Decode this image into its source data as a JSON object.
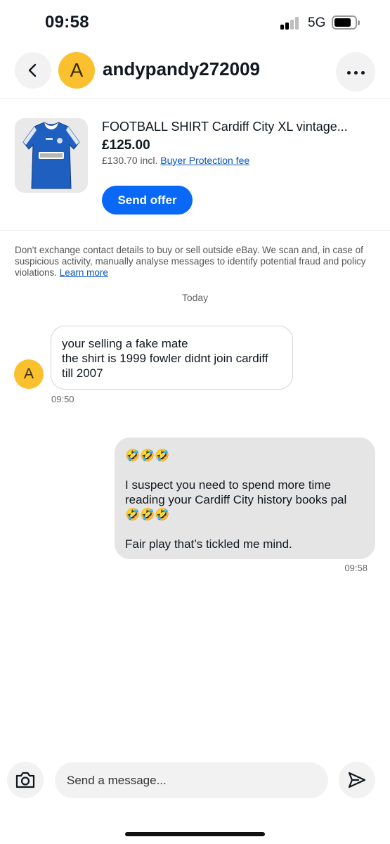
{
  "status_bar": {
    "time": "09:58",
    "network": "5G"
  },
  "header": {
    "avatar_letter": "A",
    "username": "andypandy272009"
  },
  "item": {
    "title": "FOOTBALL SHIRT Cardiff City XL vintage...",
    "price": "£125.00",
    "incl_text": "£130.70 incl. ",
    "protection_link": "Buyer Protection fee",
    "offer_button": "Send offer"
  },
  "notice": {
    "text": "Don't exchange contact details to buy or sell outside eBay. We scan and, in case of suspicious activity, manually analyse messages to identify potential fraud and policy violations. ",
    "link": "Learn more"
  },
  "day_label": "Today",
  "messages": [
    {
      "direction": "incoming",
      "avatar_letter": "A",
      "lines": [
        "your selling a fake mate",
        "the shirt is 1999 fowler didnt join cardiff till 2007"
      ],
      "time": "09:50"
    },
    {
      "direction": "outgoing",
      "lines": [
        "🤣🤣🤣",
        "",
        "I suspect you need to spend more time reading your Cardiff City history books pal 🤣🤣🤣",
        "",
        "Fair play that’s tickled me mind."
      ],
      "time": "09:58"
    }
  ],
  "composer": {
    "placeholder": "Send a message..."
  },
  "icons": {
    "back": "chevron-left-icon",
    "more": "more-horizontal-icon",
    "camera": "camera-icon",
    "send": "send-icon"
  },
  "colors": {
    "accent": "#0968f6",
    "avatar": "#fbc02d",
    "link": "#0654ba",
    "bubble_out": "#e5e5e5"
  }
}
